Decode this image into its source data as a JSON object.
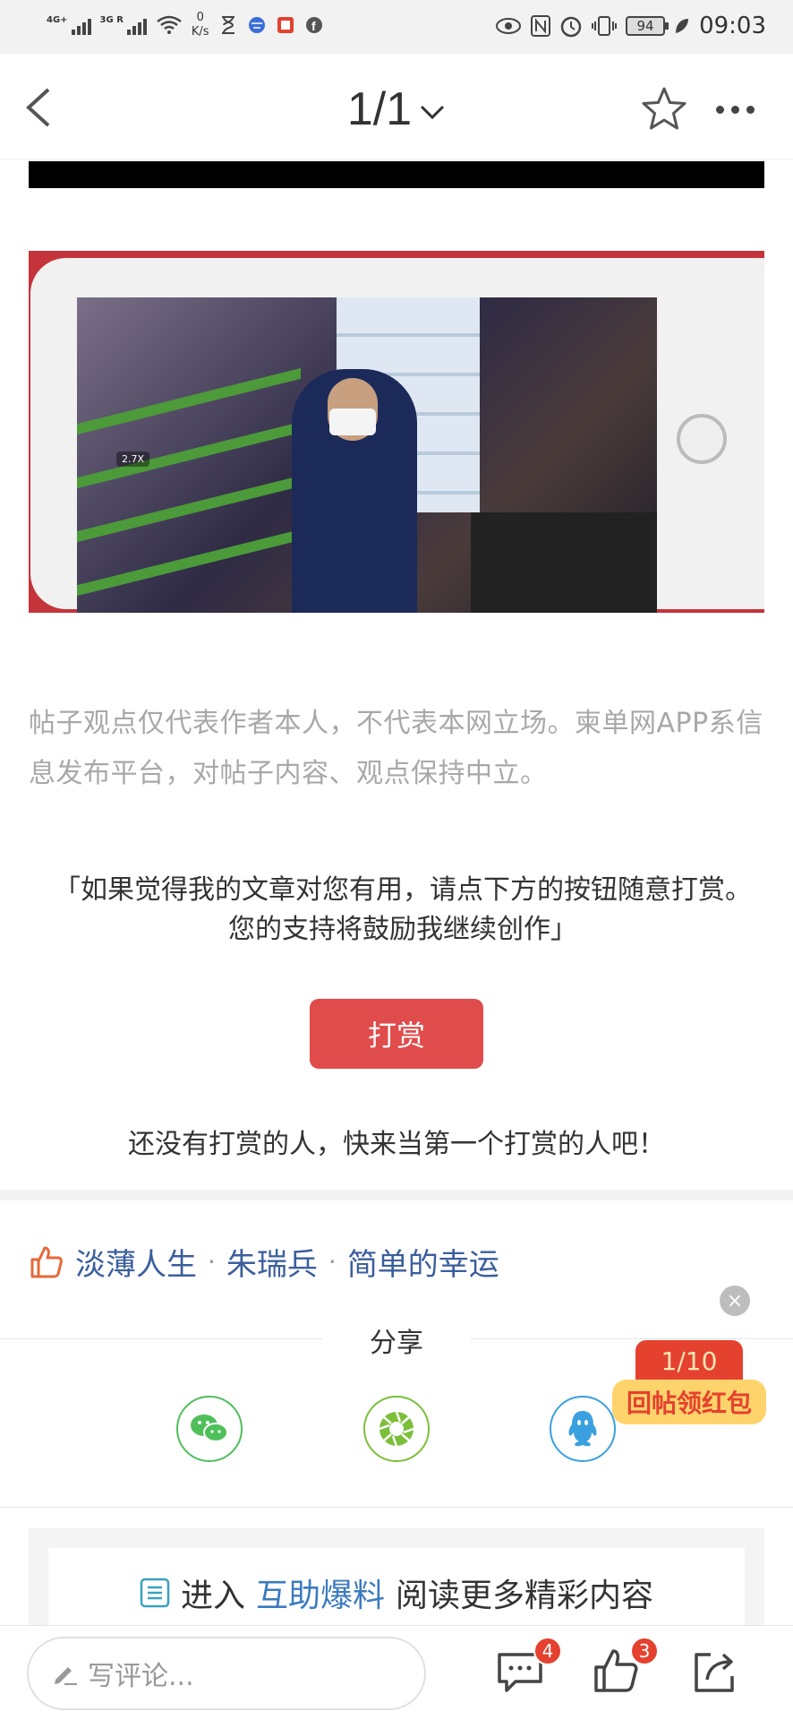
{
  "status_bar": {
    "signal1_label": "4G+",
    "signal2_label": "3G R",
    "net_speed_value": "0",
    "net_speed_unit": "K/s",
    "battery": "94",
    "time": "09:03"
  },
  "header": {
    "page_indicator": "1/1"
  },
  "image": {
    "zoom_label": "2.7X"
  },
  "disclaimer": "帖子观点仅代表作者本人，不代表本网立场。柬单网APP系信息发布平台，对帖子内容、观点保持中立。",
  "reward": {
    "quote": "「如果觉得我的文章对您有用，请点下方的按钮随意打赏。您的支持将鼓励我继续创作」",
    "button": "打赏",
    "empty_text": "还没有打赏的人，快来当第一个打赏的人吧！"
  },
  "likes": {
    "users": [
      "淡薄人生",
      "朱瑞兵",
      "简单的幸运"
    ],
    "separator": "·"
  },
  "share": {
    "label": "分享",
    "targets": [
      "wechat",
      "moments",
      "qq"
    ]
  },
  "red_packet": {
    "count": "1/10",
    "label": "回帖领红包"
  },
  "more_content": {
    "prefix": "进入",
    "link": "互助爆料",
    "suffix": "阅读更多精彩内容"
  },
  "bottom_bar": {
    "comment_placeholder": "写评论...",
    "comment_count": "4",
    "like_count": "3"
  },
  "colors": {
    "accent_red": "#e04b4b",
    "link_blue": "#3b5e9c",
    "wechat_green": "#4fbf5a",
    "qq_blue": "#3aa0e0"
  }
}
